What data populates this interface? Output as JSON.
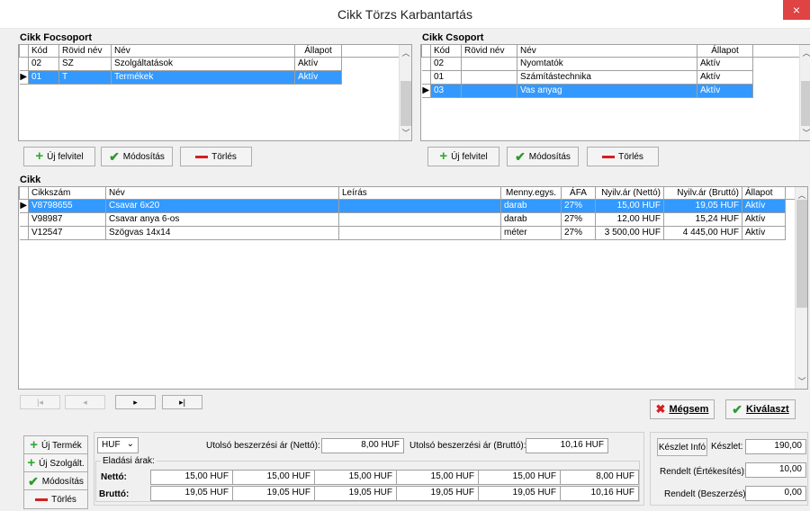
{
  "window": {
    "title": "Cikk Törzs Karbantartás",
    "close": "×"
  },
  "focsoport": {
    "label": "Cikk Focsoport",
    "headers": [
      "Kód",
      "Rövid név",
      "Név",
      "Állapot"
    ],
    "rows": [
      {
        "kod": "02",
        "rovid": "SZ",
        "nev": "Szolgáltatások",
        "allapot": "Aktív",
        "selected": false
      },
      {
        "kod": "01",
        "rovid": "T",
        "nev": "Termékek",
        "allapot": "Aktív",
        "selected": true
      }
    ],
    "buttons": {
      "new": "Új felvitel",
      "edit": "Módosítás",
      "delete": "Törlés"
    }
  },
  "csoport": {
    "label": "Cikk Csoport",
    "headers": [
      "Kód",
      "Rövid név",
      "Név",
      "Állapot"
    ],
    "rows": [
      {
        "kod": "02",
        "rovid": "",
        "nev": "Nyomtatók",
        "allapot": "Aktív",
        "selected": false
      },
      {
        "kod": "01",
        "rovid": "",
        "nev": "Számítástechnika",
        "allapot": "Aktív",
        "selected": false
      },
      {
        "kod": "03",
        "rovid": "",
        "nev": "Vas anyag",
        "allapot": "Aktív",
        "selected": true
      }
    ],
    "buttons": {
      "new": "Új felvitel",
      "edit": "Módosítás",
      "delete": "Törlés"
    }
  },
  "cikk": {
    "label": "Cikk",
    "headers": [
      "Cikkszám",
      "Név",
      "Leírás",
      "Menny.egys.",
      "ÁFA",
      "Nyilv.ár (Nettó)",
      "Nyilv.ár (Bruttó)",
      "Állapot"
    ],
    "rows": [
      {
        "cikkszam": "V8798655",
        "nev": "Csavar 6x20",
        "leiras": "",
        "egys": "darab",
        "afa": "27%",
        "netto": "15,00 HUF",
        "brutto": "19,05 HUF",
        "allapot": "Aktív",
        "selected": true
      },
      {
        "cikkszam": "V98987",
        "nev": "Csavar anya 6-os",
        "leiras": "",
        "egys": "darab",
        "afa": "27%",
        "netto": "12,00 HUF",
        "brutto": "15,24 HUF",
        "allapot": "Aktív",
        "selected": false
      },
      {
        "cikkszam": "V12547",
        "nev": "Szögvas 14x14",
        "leiras": "",
        "egys": "méter",
        "afa": "27%",
        "netto": "3 500,00 HUF",
        "brutto": "4 445,00 HUF",
        "allapot": "Aktív",
        "selected": false
      }
    ]
  },
  "nav": {
    "first": "|◂",
    "prev": "◂",
    "next": "▸",
    "last": "▸|"
  },
  "dialog": {
    "cancel": "Mégsem",
    "select": "Kiválaszt"
  },
  "bottom_buttons": {
    "new_product": "Új Termék",
    "new_service": "Új Szolgált.",
    "edit": "Módosítás",
    "delete": "Törlés"
  },
  "pricing": {
    "currency": "HUF",
    "last_net_label": "Utolsó beszerzési ár (Nettó):",
    "last_net_value": "8,00 HUF",
    "last_gross_label": "Utolsó beszerzési ár (Bruttó):",
    "last_gross_value": "10,16 HUF",
    "sales_label": "Eladási árak:",
    "net_label": "Nettó:",
    "gross_label": "Bruttó:",
    "net_values": [
      "15,00 HUF",
      "15,00 HUF",
      "15,00 HUF",
      "15,00 HUF",
      "15,00 HUF",
      "8,00 HUF"
    ],
    "gross_values": [
      "19,05 HUF",
      "19,05 HUF",
      "19,05 HUF",
      "19,05 HUF",
      "19,05 HUF",
      "10,16 HUF"
    ]
  },
  "stock": {
    "info_button": "Készlet Infó",
    "stock_label": "Készlet:",
    "stock_value": "190,00",
    "ordered_sales_label": "Rendelt (Értékesítés):",
    "ordered_sales_value": "10,00",
    "ordered_purchase_label": "Rendelt (Beszerzés):",
    "ordered_purchase_value": "0,00"
  }
}
